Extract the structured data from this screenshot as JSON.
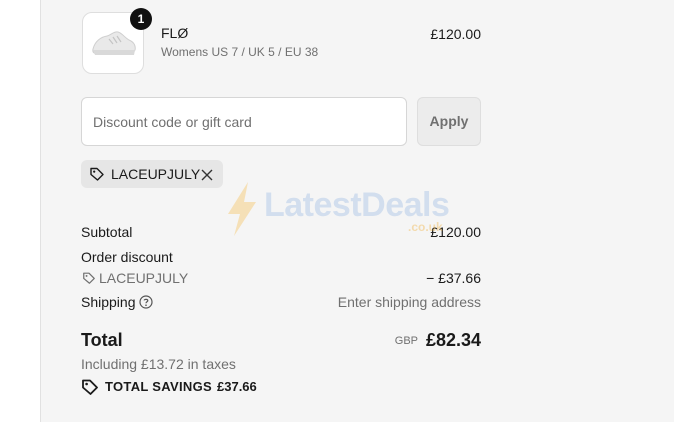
{
  "product": {
    "name": "FLØ",
    "variant": "Womens US 7 / UK 5 / EU 38",
    "price": "£120.00",
    "quantity": "1"
  },
  "discount": {
    "placeholder": "Discount code or gift card",
    "apply_label": "Apply",
    "applied_code": "LACEUPJULY"
  },
  "summary": {
    "subtotal_label": "Subtotal",
    "subtotal_value": "£120.00",
    "order_discount_label": "Order discount",
    "discount_code": "LACEUPJULY",
    "discount_value": "− £37.66",
    "shipping_label": "Shipping",
    "shipping_value": "Enter shipping address",
    "total_label": "Total",
    "currency": "GBP",
    "total_value": "£82.34",
    "tax_note": "Including £13.72 in taxes",
    "savings_label": "TOTAL SAVINGS",
    "savings_value": "£37.66"
  },
  "watermark": {
    "text": "LatestDeals",
    "sub": ".co.uk"
  },
  "colors": {
    "summary_background": "#f5f5f5",
    "muted_text": "#707070",
    "badge": "#111111"
  }
}
